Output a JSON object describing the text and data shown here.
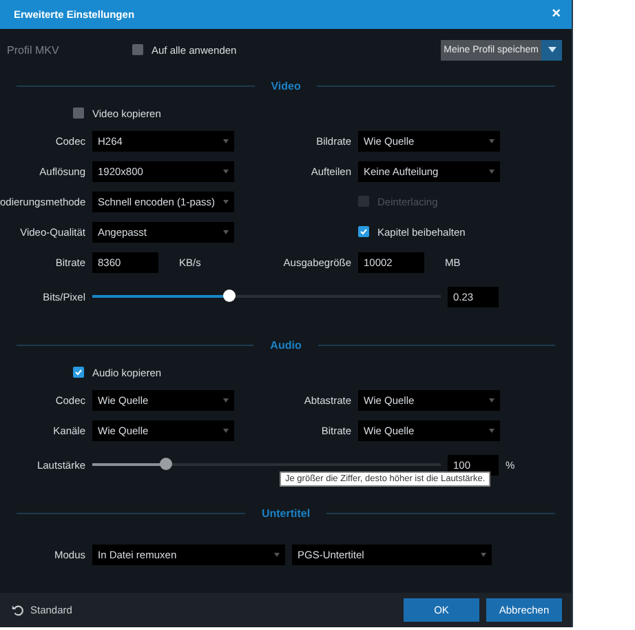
{
  "window": {
    "title": "Erweiterte Einstellungen",
    "close": "×"
  },
  "profile": {
    "label": "Profil  MKV",
    "apply_all": {
      "label": "Auf alle anwenden",
      "checked": false
    },
    "save_button": "Meine Profil speichem"
  },
  "sections": [
    {
      "title": "Video",
      "copy": {
        "label": "Video kopieren",
        "checked": false
      },
      "rows": [
        {
          "kind": "selects",
          "left": {
            "label": "Codec",
            "value": "H264"
          },
          "right": {
            "label": "Bildrate",
            "value": "Wie Quelle"
          }
        },
        {
          "kind": "selects",
          "left": {
            "label": "Auflösung",
            "value": "1920x800"
          },
          "right": {
            "label": "Aufteilen",
            "value": "Keine Aufteilung"
          }
        },
        {
          "kind": "select_check",
          "left": {
            "label": "odierungsmethode",
            "value": "Schnell encoden (1-pass)"
          },
          "right": {
            "label": "Deinterlacing",
            "checked": false,
            "disabled": true
          }
        },
        {
          "kind": "select_check",
          "left": {
            "label": "Video-Qualität",
            "value": "Angepasst"
          },
          "right": {
            "label": "Kapitel beibehalten",
            "checked": true,
            "disabled": false
          }
        },
        {
          "kind": "inputs",
          "left": {
            "label": "Bitrate",
            "value": "8360",
            "unit": "KB/s"
          },
          "right": {
            "label": "Ausgabegröße",
            "value": "10002",
            "unit": "MB"
          }
        },
        {
          "kind": "slider",
          "label": "Bits/Pixel",
          "level": 0.39,
          "value": "0.23",
          "accent": true
        }
      ]
    },
    {
      "title": "Audio",
      "copy": {
        "label": "Audio kopieren",
        "checked": true
      },
      "rows": [
        {
          "kind": "selects",
          "left": {
            "label": "Codec",
            "value": "Wie Quelle"
          },
          "right": {
            "label": "Abtastrate",
            "value": "Wie Quelle"
          }
        },
        {
          "kind": "selects",
          "left": {
            "label": "Kanäle",
            "value": "Wie Quelle"
          },
          "right": {
            "label": "Bitrate",
            "value": "Wie Quelle"
          }
        },
        {
          "kind": "slider",
          "label": "Lautstärke",
          "level": 0.21,
          "value": "100",
          "unit": "%",
          "accent": false,
          "tooltip": "Je größer die Ziffer, desto höher ist die Lautstärke."
        }
      ]
    },
    {
      "title": "Untertitel",
      "rows": [
        {
          "kind": "wide",
          "label": "Modus",
          "values": [
            "In Datei remuxen",
            "PGS-Untertitel"
          ]
        }
      ]
    }
  ],
  "footer": {
    "reset": "Standard",
    "buttons": [
      "OK",
      "Abbrechen"
    ]
  }
}
